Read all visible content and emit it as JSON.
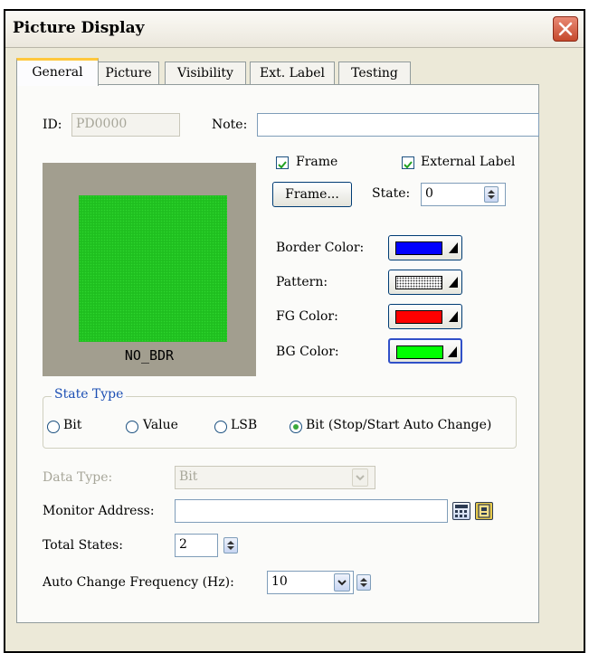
{
  "window": {
    "title": "Picture Display"
  },
  "tabs": [
    {
      "label": "General",
      "active": true
    },
    {
      "label": "Picture"
    },
    {
      "label": "Visibility"
    },
    {
      "label": "Ext. Label"
    },
    {
      "label": "Testing"
    }
  ],
  "general": {
    "id_label": "ID:",
    "id_value": "PD0000",
    "note_label": "Note:",
    "note_value": "",
    "preview_name": "NO_BDR",
    "frame_checkbox": {
      "label": "Frame",
      "checked": true
    },
    "external_label_checkbox": {
      "label": "External Label",
      "checked": true
    },
    "frame_button": "Frame...",
    "state_label": "State:",
    "state_value": "0",
    "border_color_label": "Border Color:",
    "pattern_label": "Pattern:",
    "fg_color_label": "FG Color:",
    "bg_color_label": "BG Color:",
    "colors": {
      "border": "#0000ff",
      "fg": "#ff0000",
      "bg": "#00ff00",
      "preview": "#1fbf1f"
    }
  },
  "state_type": {
    "label": "State Type",
    "options": [
      "Bit",
      "Value",
      "LSB",
      "Bit (Stop/Start Auto Change)"
    ],
    "selected": "Bit (Stop/Start Auto Change)"
  },
  "data_type": {
    "label": "Data Type:",
    "value": "Bit",
    "disabled": true
  },
  "monitor_address": {
    "label": "Monitor Address:",
    "value": ""
  },
  "total_states": {
    "label": "Total States:",
    "value": "2"
  },
  "auto_change": {
    "label": "Auto Change Frequency (Hz):",
    "value": "10"
  }
}
